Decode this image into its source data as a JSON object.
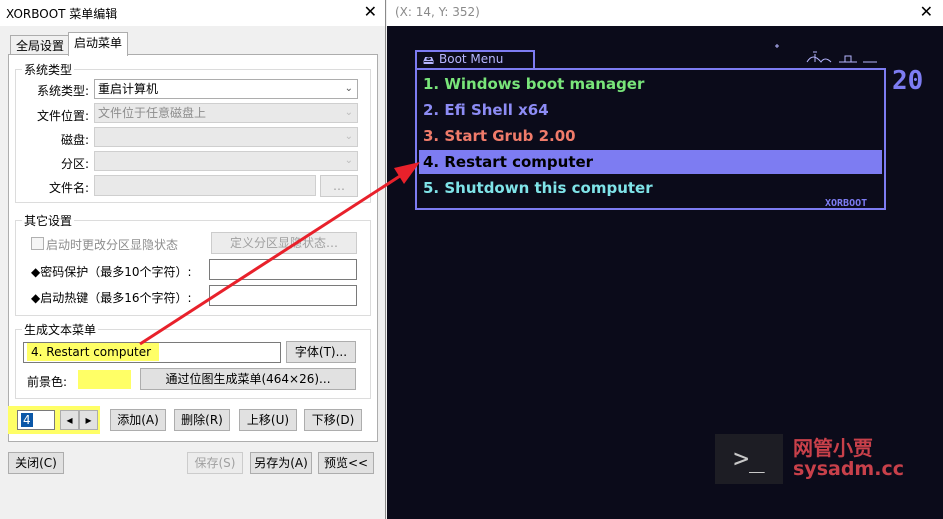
{
  "dialog": {
    "title": "XORBOOT 菜单编辑",
    "close_glyph": "✕",
    "tabs": [
      {
        "label": "全局设置",
        "active": false
      },
      {
        "label": "启动菜单",
        "active": true
      }
    ],
    "system_type_group": {
      "title": "系统类型",
      "fields": [
        {
          "label": "系统类型:",
          "value": "重启计算机",
          "disabled": false
        },
        {
          "label": "文件位置:",
          "value": "文件位于任意磁盘上",
          "disabled": true
        },
        {
          "label": "磁盘:",
          "value": "",
          "disabled": true
        },
        {
          "label": "分区:",
          "value": "",
          "disabled": true
        }
      ],
      "filename_label": "文件名:",
      "browse_label": "…"
    },
    "other_group": {
      "title": "其它设置",
      "checkbox_label": "启动时更改分区显隐状态",
      "define_button": "定义分区显隐状态…",
      "password_label": "◆密码保护（最多10个字符）:",
      "hotkey_label": "◆启动热键（最多16个字符）:"
    },
    "text_menu_group": {
      "title": "生成文本菜单",
      "menu_text": "4.  Restart computer",
      "font_button": "字体(T)...",
      "foreground_label": "前景色:",
      "bitmap_button": "通过位图生成菜单(464×26)..."
    },
    "index_value": "4",
    "spin_left": "◂",
    "spin_right": "▸",
    "buttons": {
      "add": "添加(A)",
      "delete": "删除(R)",
      "up": "上移(U)",
      "down": "下移(D)",
      "close": "关闭(C)",
      "save": "保存(S)",
      "save_as": "另存为(A)",
      "preview": "预览<<"
    },
    "colors": {
      "highlight": "#ffff66",
      "foreground_swatch": "#ffff66"
    }
  },
  "preview": {
    "coord_text": "(X: 14, Y: 352)",
    "close_glyph": "✕",
    "menu_title": "Boot Menu",
    "menu_icon": "🖴",
    "counter": "20",
    "brand": "XORBOOT",
    "items": [
      {
        "label": "1.  Windows boot manager",
        "color": "#79e57a",
        "selected": false
      },
      {
        "label": "2.  Efi Shell x64",
        "color": "#8d8cf5",
        "selected": false
      },
      {
        "label": "3.  Start Grub 2.00",
        "color": "#f07b6a",
        "selected": false
      },
      {
        "label": "4.  Restart computer",
        "color": "#000000",
        "selected": true
      },
      {
        "label": "5.  Shutdown this computer",
        "color": "#7fe3e8",
        "selected": false
      }
    ],
    "terminal_icon": ">_",
    "watermark_cn": "网管小贾",
    "watermark_url": "sysadm.cc",
    "colors": {
      "frame": "#7d7cf2",
      "background": "#0b0b1a",
      "arrow": "#e8212b"
    }
  }
}
